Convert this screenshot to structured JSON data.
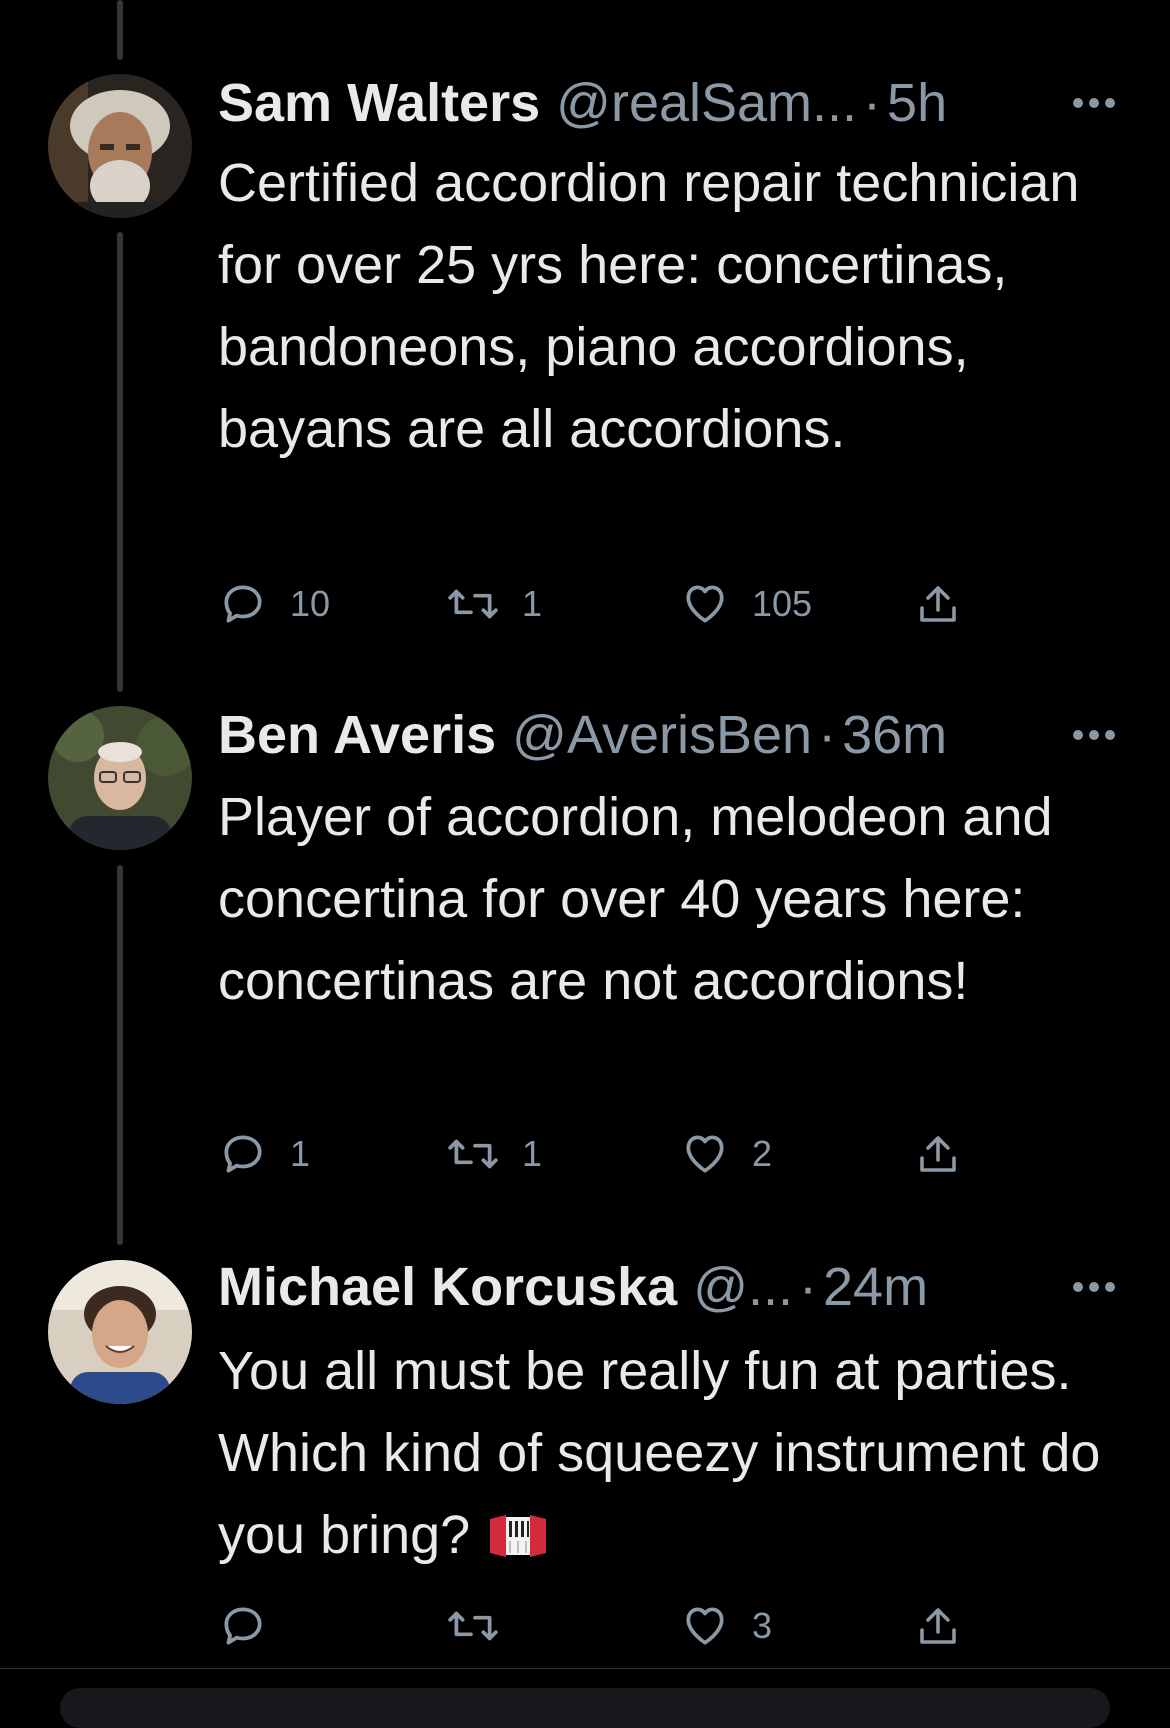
{
  "tweets": [
    {
      "display_name": "Sam Walters",
      "handle": "@realSam...",
      "separator": "·",
      "time": "5h",
      "text": "Certified accordion repair technician for over 25 yrs here: concertinas, bandoneons, piano accordions, bayans are all accordions.",
      "replies": "10",
      "retweets": "1",
      "likes": "105",
      "avatar": "bearded-man-avatar"
    },
    {
      "display_name": "Ben Averis",
      "handle": "@AverisBen",
      "separator": "·",
      "time": "36m",
      "text": "Player of accordion, melodeon and concertina for over 40 years here: concertinas are not accordions!",
      "replies": "1",
      "retweets": "1",
      "likes": "2",
      "avatar": "man-glasses-avatar"
    },
    {
      "display_name": "Michael Korcuska",
      "handle": "@...",
      "separator": "·",
      "time": "24m",
      "text": "You all must be really fun at parties. Which kind of squeezy instrument do you bring?",
      "replies": "",
      "retweets": "",
      "likes": "3",
      "avatar": "smiling-man-avatar",
      "emoji": "accordion-emoji"
    }
  ],
  "icons": {
    "reply": "reply-icon",
    "retweet": "retweet-icon",
    "like": "heart-icon",
    "share": "share-icon",
    "more": "more-options-icon"
  },
  "colors": {
    "background": "#000000",
    "primary_text": "#e7e9ea",
    "secondary_text": "#8b98a5",
    "thread_line": "#333639"
  }
}
